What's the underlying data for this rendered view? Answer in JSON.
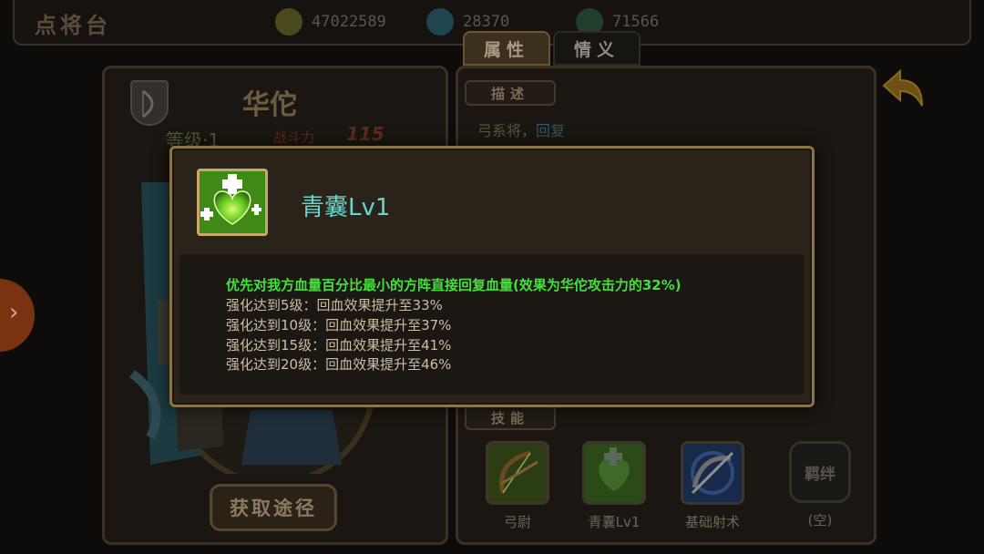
{
  "topbar": {
    "title": "点将台",
    "resources": [
      {
        "name": "gold",
        "icon": "coin-icon",
        "value": "47022589",
        "color": "#6a6a2a"
      },
      {
        "name": "gems",
        "icon": "gem-icon",
        "value": "28370",
        "color": "#2a5a66"
      },
      {
        "name": "leaf",
        "icon": "leaf-icon",
        "value": "71566",
        "color": "#2f5a3c"
      }
    ]
  },
  "tabs": {
    "attributes": "属性",
    "bonds": "情义"
  },
  "hero": {
    "name": "华佗",
    "level_label": "等级·1",
    "power_label": "战斗力",
    "power_value": "115",
    "acquire_button": "获取途径"
  },
  "description": {
    "header": "描述",
    "class_text": "弓系将，",
    "heal_text": "回复"
  },
  "skills": {
    "header": "技能",
    "items": [
      {
        "label": "弓尉",
        "icon": "bow-icon"
      },
      {
        "label": "青囊Lv1",
        "icon": "heart-heal-icon"
      },
      {
        "label": "基础射术",
        "icon": "crossbow-icon"
      },
      {
        "label": "(空)",
        "icon": "bond-empty-icon",
        "slot_text": "羁绊"
      }
    ]
  },
  "popup": {
    "title": "青囊Lv1",
    "icon": "heart-heal-icon",
    "effect_main": "优先对我方血量百分比最小的方阵直接回复血量(效果为华佗攻击力的32%)",
    "upgrades": [
      "强化达到5级：回血效果提升至33%",
      "强化达到10级：回血效果提升至37%",
      "强化达到15级：回血效果提升至41%",
      "强化达到20级：回血效果提升至46%"
    ]
  },
  "colors": {
    "popup_title": "#63d9ce",
    "effect_green": "#43e03b",
    "popup_border": "#8a7346"
  }
}
